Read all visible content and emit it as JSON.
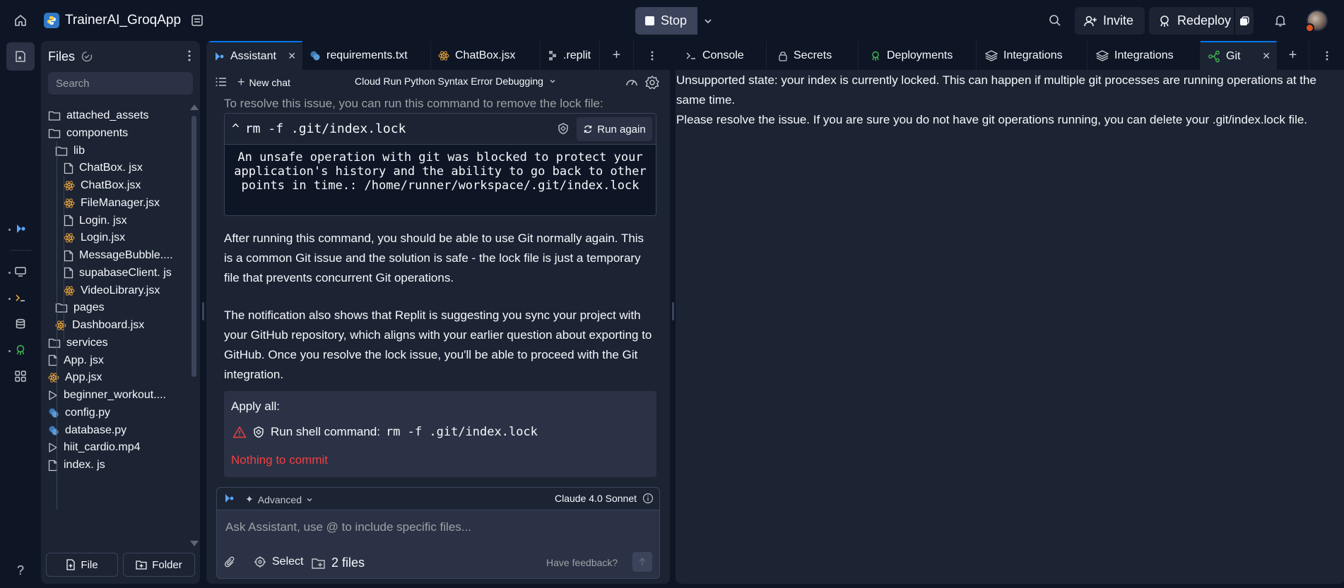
{
  "app": {
    "project_name": "TrainerAI_GroqApp",
    "stop_label": "Stop",
    "invite_label": "Invite",
    "redeploy_label": "Redeploy"
  },
  "files": {
    "title": "Files",
    "search_placeholder": "Search",
    "items": [
      {
        "name": "attached_assets",
        "type": "folder"
      },
      {
        "name": "components",
        "type": "folder"
      },
      {
        "name": "lib",
        "type": "folder"
      },
      {
        "name": "ChatBox. jsx",
        "type": "file"
      },
      {
        "name": "ChatBox.jsx",
        "type": "react"
      },
      {
        "name": "FileManager.jsx",
        "type": "react"
      },
      {
        "name": "Login. jsx",
        "type": "file"
      },
      {
        "name": "Login.jsx",
        "type": "react"
      },
      {
        "name": "MessageBubble....",
        "type": "file"
      },
      {
        "name": "supabaseClient. js",
        "type": "file"
      },
      {
        "name": "VideoLibrary.jsx",
        "type": "react"
      },
      {
        "name": "pages",
        "type": "folder"
      },
      {
        "name": "Dashboard.jsx",
        "type": "react"
      },
      {
        "name": "services",
        "type": "folder"
      },
      {
        "name": "App. jsx",
        "type": "file"
      },
      {
        "name": "App.jsx",
        "type": "react"
      },
      {
        "name": "beginner_workout....",
        "type": "video"
      },
      {
        "name": "config.py",
        "type": "python"
      },
      {
        "name": "database.py",
        "type": "python"
      },
      {
        "name": "hiit_cardio.mp4",
        "type": "video"
      },
      {
        "name": "index. js",
        "type": "file"
      }
    ],
    "file_button": "File",
    "folder_button": "Folder"
  },
  "editor_tabs": [
    {
      "label": "Assistant"
    },
    {
      "label": "requirements.txt"
    },
    {
      "label": "ChatBox.jsx"
    },
    {
      "label": ".replit"
    }
  ],
  "assistant": {
    "new_chat_label": "New chat",
    "chat_title": "Cloud Run Python Syntax Error Debugging",
    "intro_text": "To resolve this issue, you can run this command to remove the lock file:",
    "code_prompt": "^",
    "code_command": "rm -f .git/index.lock",
    "run_again_label": "Run again",
    "code_output": "An unsafe operation with git was blocked to protect your\napplication's history and the ability to go back to other\npoints in time.: /home/runner/workspace/.git/index.lock",
    "para1": "After running this command, you should be able to use Git normally again. This is a common Git issue and the solution is safe - the lock file is just a temporary file that prevents concurrent Git operations.",
    "para2": "The notification also shows that Replit is suggesting you sync your project with your GitHub repository, which aligns with your earlier question about exporting to GitHub. Once you resolve the lock issue, you'll be able to proceed with the Git integration.",
    "apply_all_label": "Apply all:",
    "shell_label": "Run shell command:",
    "shell_command": "rm -f .git/index.lock",
    "nothing_to_commit": "Nothing to commit",
    "advanced_label": "Advanced",
    "model_label": "Claude 4.0 Sonnet",
    "input_placeholder": "Ask Assistant, use @ to include specific files...",
    "select_label": "Select",
    "files_count_label": "2 files",
    "feedback_label": "Have feedback?"
  },
  "right_tabs": [
    {
      "label": "Console"
    },
    {
      "label": "Secrets"
    },
    {
      "label": "Deployments"
    },
    {
      "label": "Integrations"
    },
    {
      "label": "Integrations"
    },
    {
      "label": "Git"
    }
  ],
  "git": {
    "message_line1": "Unsupported state: your index is currently locked. This can happen if multiple git processes are running operations at the same time.",
    "message_line2": "Please resolve the issue. If you are sure you do not have git operations running, you can delete your .git/index.lock file."
  },
  "colors": {
    "background": "#0e1525",
    "panel": "#1c2333",
    "accent": "#0079f2",
    "error": "#f23f42",
    "react_icon": "#e5a33b"
  }
}
